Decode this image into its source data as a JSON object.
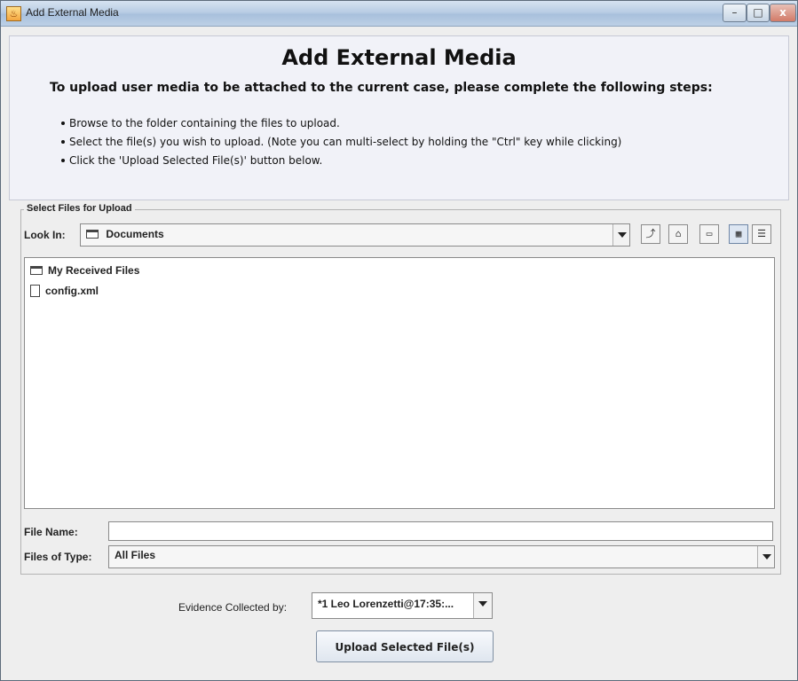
{
  "window": {
    "title": "Add External Media",
    "controls": {
      "minimize": "–",
      "maximize": "□",
      "close": "x"
    }
  },
  "header": {
    "title": "Add External Media",
    "subtitle": "To upload user media to be attached to the current case, please complete the following steps:",
    "steps": [
      "Browse to the folder containing the files to upload.",
      "Select the file(s) you wish to upload. (Note you can multi-select by holding the \"Ctrl\" key while clicking)",
      "Click the 'Upload Selected File(s)' button below."
    ]
  },
  "file_chooser": {
    "group_title": "Select Files for Upload",
    "look_in_label": "Look In:",
    "look_in_value": "Documents",
    "toolbar_icons": [
      "up-folder-icon",
      "home-icon",
      "new-folder-icon",
      "list-view-icon",
      "details-view-icon"
    ],
    "files": [
      {
        "name": "My Received Files",
        "icon": "folder-icon"
      },
      {
        "name": "config.xml",
        "icon": "file-icon"
      }
    ],
    "file_name_label": "File Name:",
    "file_name_value": "",
    "files_of_type_label": "Files of Type:",
    "files_of_type_value": "All Files"
  },
  "evidence": {
    "label": "Evidence Collected by:",
    "value": "*1 Leo Lorenzetti@17:35:..."
  },
  "upload_button": "Upload Selected File(s)"
}
